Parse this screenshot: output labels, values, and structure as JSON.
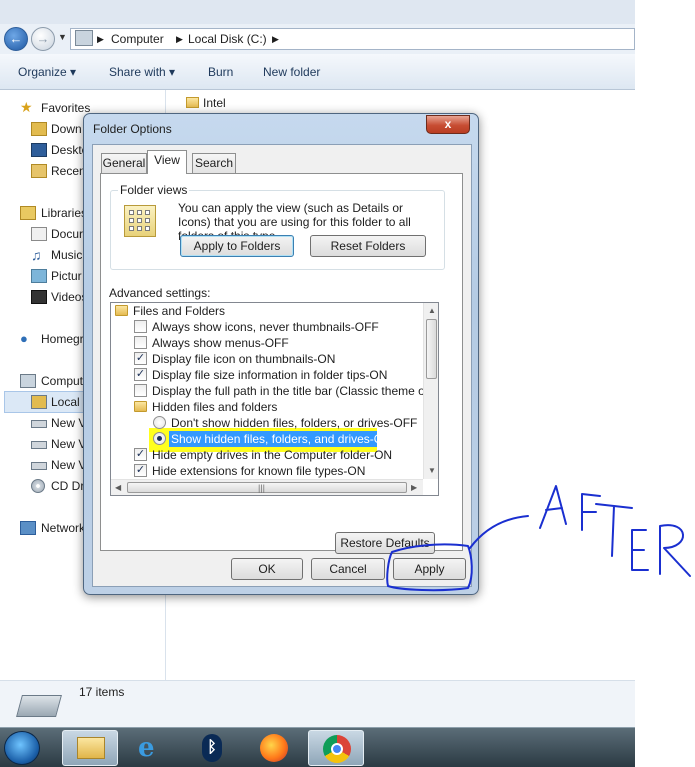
{
  "explorer": {
    "breadcrumb": [
      "Computer",
      "Local Disk (C:)"
    ],
    "toolbar": [
      "Organize",
      "Share with",
      "Burn",
      "New folder"
    ],
    "nav": {
      "favorites": "Favorites",
      "downloads": "Down",
      "desktop": "Deskto",
      "recent": "Recen",
      "libraries": "Libraries",
      "documents": "Docur",
      "music": "Music",
      "pictures": "Pictur",
      "videos": "Videos",
      "homegroup": "Homegr",
      "computer": "Comput",
      "local_disk": "Local",
      "new_v1": "New V",
      "new_v2": "New V",
      "new_v3": "New V",
      "cd_drive": "CD Dr",
      "network": "Network"
    },
    "main_item": "Intel",
    "status": "17 items"
  },
  "dialog": {
    "title": "Folder Options",
    "close": "x",
    "tabs": [
      "General",
      "View",
      "Search"
    ],
    "folder_views": {
      "legend": "Folder views",
      "description": "You can apply the view (such as Details or Icons) that you are using for this folder to all folders of this type.",
      "apply_to_folders": "Apply to Folders",
      "reset_folders": "Reset Folders"
    },
    "advanced_label": "Advanced settings:",
    "settings": [
      {
        "type": "folder",
        "label": "Files and Folders"
      },
      {
        "type": "checkbox",
        "checked": false,
        "label": "Always show icons, never thumbnails-OFF"
      },
      {
        "type": "checkbox",
        "checked": false,
        "label": "Always show menus-OFF"
      },
      {
        "type": "checkbox",
        "checked": true,
        "label": "Display file icon on thumbnails-ON"
      },
      {
        "type": "checkbox",
        "checked": true,
        "label": "Display file size information in folder tips-ON"
      },
      {
        "type": "checkbox",
        "checked": false,
        "label": "Display the full path in the title bar (Classic theme only)-OF"
      },
      {
        "type": "folder",
        "label": "Hidden files and folders"
      },
      {
        "type": "radio",
        "checked": false,
        "label": "Don't show hidden files, folders, or drives-OFF"
      },
      {
        "type": "radio",
        "checked": true,
        "label": "Show hidden files, folders, and drives-ON"
      },
      {
        "type": "checkbox",
        "checked": true,
        "label": "Hide empty drives in the Computer folder-ON"
      },
      {
        "type": "checkbox",
        "checked": true,
        "label": "Hide extensions for known file types-ON"
      }
    ],
    "restore_defaults": "Restore Defaults",
    "ok": "OK",
    "cancel": "Cancel",
    "apply": "Apply"
  },
  "annotation": {
    "text": "AFTER",
    "color": "#1a2fd0",
    "highlight_color": "#ffff1e"
  }
}
